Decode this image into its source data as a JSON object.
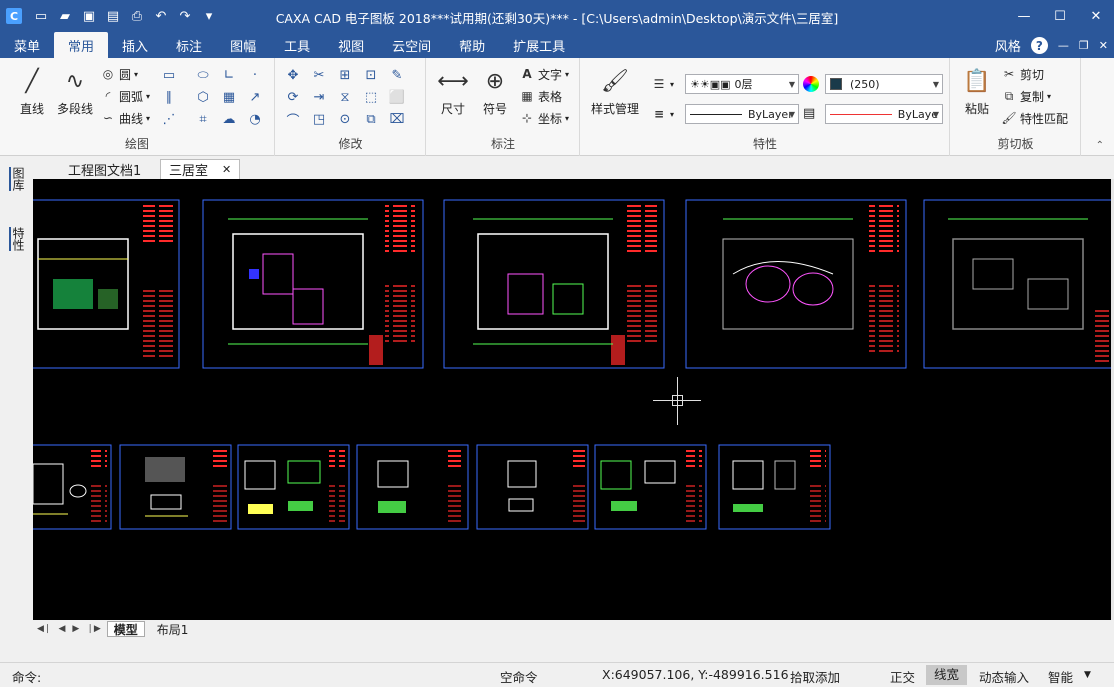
{
  "window": {
    "title": "CAXA CAD 电子图板 2018***试用期(还剩30天)*** - [C:\\Users\\admin\\Desktop\\演示文件\\三居室]",
    "app_logo": "C",
    "qat_icons": [
      "new-file-icon",
      "open-folder-icon",
      "save-icon",
      "save-all-icon",
      "print-icon",
      "undo-icon",
      "redo-icon",
      "dropdown-icon"
    ]
  },
  "tabs": [
    "菜单",
    "常用",
    "插入",
    "标注",
    "图幅",
    "工具",
    "视图",
    "云空间",
    "帮助",
    "扩展工具"
  ],
  "tab_right": {
    "style": "风格",
    "help": "?"
  },
  "groups": {
    "draw": {
      "label": "绘图",
      "line": "直线",
      "polyline": "多段线",
      "circle": "圆",
      "arc": "圆弧",
      "curve": "曲线"
    },
    "modify": {
      "label": "修改"
    },
    "annotate": {
      "label": "标注",
      "dimension": "尺寸",
      "symbol": "符号",
      "text": "文字",
      "table": "表格",
      "coordinate": "坐标"
    },
    "properties": {
      "label": "特性",
      "style_manage": "样式管理",
      "layer": "0层",
      "color_value": "(250)",
      "linetype": "ByLayer",
      "linewidth": "ByLaye"
    },
    "clipboard": {
      "label": "剪切板",
      "paste": "粘贴",
      "cut": "剪切",
      "copy": "复制",
      "match": "特性匹配"
    }
  },
  "doc_tabs": [
    "工程图文档1",
    "三居室"
  ],
  "side_tabs": [
    "图库",
    "特性"
  ],
  "layout_tabs": [
    "模型",
    "布局1"
  ],
  "status": {
    "command_label": "命令:",
    "empty_command": "空命令",
    "coords": "X:649057.106, Y:-489916.516",
    "pick_mode": "拾取添加",
    "ortho": "正交",
    "line_width": "线宽",
    "dynamic_input": "动态输入",
    "smart": "智能"
  },
  "colors": {
    "accent": "#2b579a",
    "canvas": "#000000",
    "sheet_border": "#3a6cff",
    "title_block_red": "#ff2a2a"
  }
}
